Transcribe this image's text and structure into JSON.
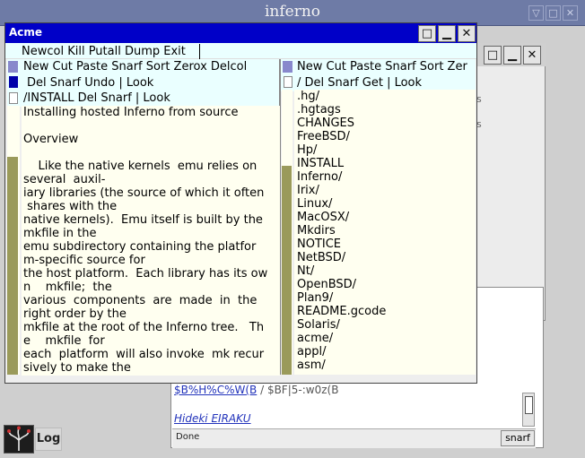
{
  "window": {
    "title": "inferno",
    "controls": [
      "▽",
      "□",
      "✕"
    ]
  },
  "acme": {
    "title": "Acme",
    "main_tag": "Newcol Kill Putall Dump Exit",
    "columns": [
      {
        "tag": "New Cut Paste Snarf Sort Zerox Delcol"
      },
      {
        "tag": "New Cut Paste Snarf Sort Zer"
      }
    ],
    "file_window": {
      "tag": "Del Snarf Undo | Look",
      "filename_tag": "/INSTALL Del Snarf | Look",
      "lines": [
        "Installing hosted Inferno from source",
        "",
        "Overview",
        "",
        "    Like the native kernels  emu relies on",
        "several  auxil-",
        "iary libraries (the source of which it often",
        " shares with the",
        "native kernels).  Emu itself is built by the",
        "mkfile in the",
        "emu subdirectory containing the platfor",
        "m-specific source for",
        "the host platform.  Each library has its ow",
        "n    mkfile;  the",
        "various  components  are  made  in  the",
        "right order by the",
        "mkfile at the root of the Inferno tree.   Th",
        "e    mkfile  for",
        "each  platform  will also invoke  mk recur",
        "sively to make the"
      ]
    },
    "dir_window": {
      "tag": "/ Del Snarf Get | Look",
      "entries": [
        ".hg/",
        ".hgtags",
        "CHANGES",
        "FreeBSD/",
        "Hp/",
        "INSTALL",
        "Inferno/",
        "Irix/",
        "Linux/",
        "MacOSX/",
        "Mkdirs",
        "NOTICE",
        "NetBSD/",
        "Nt/",
        "OpenBSD/",
        "Plan9/",
        "README.gcode",
        "Solaris/",
        "acme/",
        "appl/",
        "asm/"
      ]
    }
  },
  "browser": {
    "line1_link": "$B%H%C%W(B",
    "line1_rest": " / $BF|5-:w0z(B",
    "author": "Hideki EIRAKU",
    "status": "Done",
    "snarf": "snarf"
  },
  "bg_fragments": [
    "s",
    "s"
  ],
  "launcher": {
    "log_label": "Log"
  },
  "colors": {
    "titlebar": "#6e7ba6",
    "acme_title": "#0000c8",
    "tag_bg": "#eaffff",
    "body_bg": "#fffff0"
  }
}
